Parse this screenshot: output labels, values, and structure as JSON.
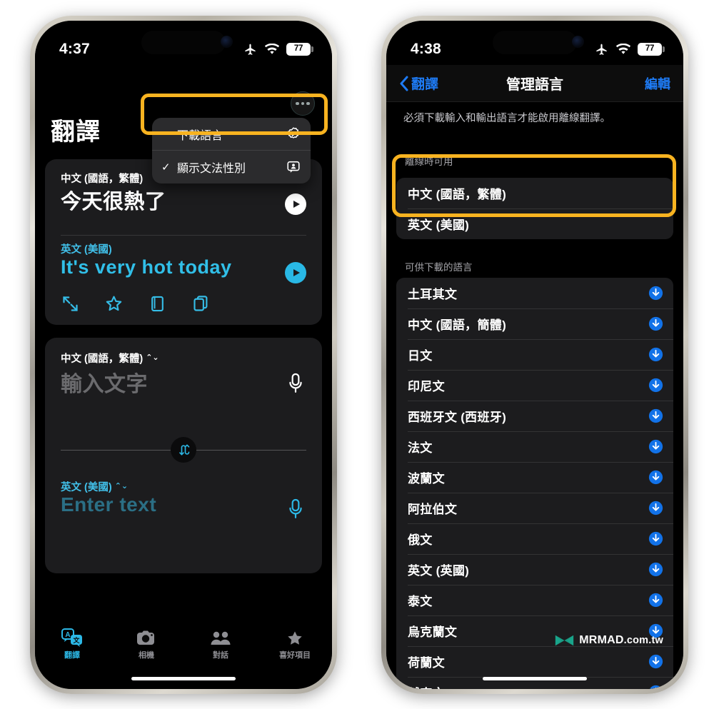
{
  "left_phone": {
    "status_bar": {
      "time": "4:37",
      "airplane_icon": "airplane-icon",
      "wifi_icon": "wifi-icon",
      "battery_pct": "77"
    },
    "app_title": "翻譯",
    "more_button": "more-options-button",
    "menu": {
      "items": [
        {
          "label": "下載語言",
          "icon": "gear-arrow-icon",
          "checked": false
        },
        {
          "label": "顯示文法性別",
          "icon": "person-bubble-icon",
          "checked": true,
          "check_glyph": "✓"
        }
      ]
    },
    "result_card": {
      "source_lang": "中文 (國語，繁體)",
      "source_text": "今天很熱了",
      "target_lang": "英文 (美國)",
      "target_text": "It's very hot today",
      "actions": [
        "expand-icon",
        "star-icon",
        "dictionary-icon",
        "copy-icon"
      ]
    },
    "input_card": {
      "source_lang": "中文 (國語，繁體)",
      "source_placeholder": "輸入文字",
      "target_lang": "英文 (美國)",
      "target_placeholder": "Enter text",
      "swap_icon": "swap-arrows-icon",
      "mic_icon": "microphone-icon"
    },
    "tabs": [
      {
        "label": "翻譯",
        "icon": "translate-icon",
        "active": true
      },
      {
        "label": "相機",
        "icon": "camera-icon",
        "active": false
      },
      {
        "label": "對話",
        "icon": "conversation-icon",
        "active": false
      },
      {
        "label": "喜好項目",
        "icon": "star-icon",
        "active": false
      }
    ]
  },
  "right_phone": {
    "status_bar": {
      "time": "4:38",
      "airplane_icon": "airplane-icon",
      "wifi_icon": "wifi-icon",
      "battery_pct": "77"
    },
    "nav": {
      "back_label": "翻譯",
      "back_icon": "chevron-left-icon",
      "title": "管理語言",
      "edit_label": "編輯"
    },
    "note": "必須下載輸入和輸出語言才能啟用離線翻譯。",
    "offline_section": {
      "header": "離線時可用",
      "items": [
        {
          "name": "中文 (國語，繁體)"
        },
        {
          "name": "英文 (美國)"
        }
      ]
    },
    "available_section": {
      "header": "可供下載的語言",
      "items": [
        {
          "name": "土耳其文",
          "action_icon": "download-icon"
        },
        {
          "name": "中文 (國語，簡體)",
          "action_icon": "download-icon"
        },
        {
          "name": "日文",
          "action_icon": "download-icon"
        },
        {
          "name": "印尼文",
          "action_icon": "download-icon"
        },
        {
          "name": "西班牙文 (西班牙)",
          "action_icon": "download-icon"
        },
        {
          "name": "法文",
          "action_icon": "download-icon"
        },
        {
          "name": "波蘭文",
          "action_icon": "download-icon"
        },
        {
          "name": "阿拉伯文",
          "action_icon": "download-icon"
        },
        {
          "name": "俄文",
          "action_icon": "download-icon"
        },
        {
          "name": "英文 (英國)",
          "action_icon": "download-icon"
        },
        {
          "name": "泰文",
          "action_icon": "download-icon"
        },
        {
          "name": "烏克蘭文",
          "action_icon": "download-icon"
        },
        {
          "name": "荷蘭文",
          "action_icon": "download-icon"
        },
        {
          "name": "越南文",
          "action_icon": "download-icon"
        }
      ]
    }
  },
  "watermark": {
    "text": "MRMAD",
    "tld": ".com.tw",
    "logo_icon": "mrmad-bowtie-logo"
  },
  "colors": {
    "highlight": "#f8b320",
    "accent_cyan": "#2cb8e6",
    "accent_blue": "#1e7bf5",
    "card_bg": "#1c1c1e",
    "screen_bg": "#000000",
    "watermark_teal": "#1aa58c"
  }
}
